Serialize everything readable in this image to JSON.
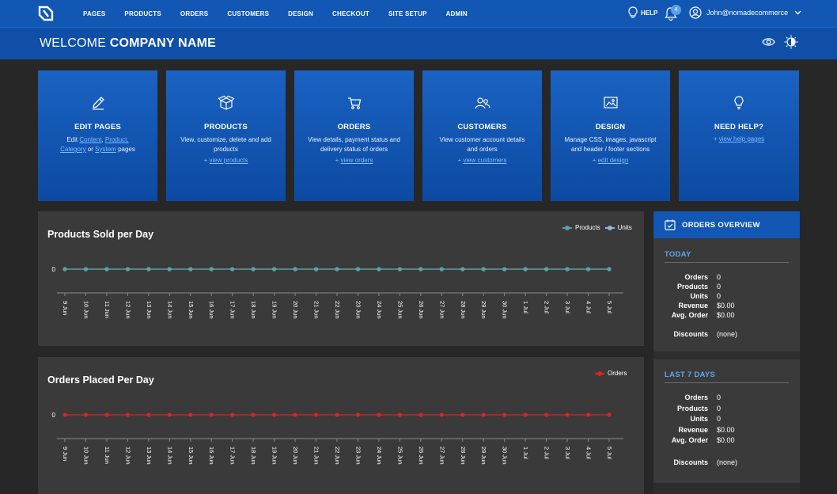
{
  "nav": {
    "items": [
      "PAGES",
      "PRODUCTS",
      "ORDERS",
      "CUSTOMERS",
      "DESIGN",
      "CHECKOUT",
      "SITE SETUP",
      "ADMIN"
    ],
    "help": "HELP",
    "notifications": "4",
    "user": "John@nomadecommerce"
  },
  "welcome": {
    "prefix": "WELCOME",
    "company": "COMPANY NAME"
  },
  "cards": {
    "edit": {
      "title": "EDIT PAGES",
      "edit_word": "Edit",
      "l1": "Content",
      "l2": "Product,",
      "l3": "Category",
      "or": "or",
      "l4": "System",
      "pages": "pages"
    },
    "products": {
      "title": "PRODUCTS",
      "desc": "View, customize, delete and add products",
      "plus": "+",
      "link": "view products"
    },
    "orders": {
      "title": "ORDERS",
      "desc": "View details, payment status and delivery status of orders",
      "plus": "+",
      "link": "view orders"
    },
    "customers": {
      "title": "CUSTOMERS",
      "desc": "View customer account details and orders",
      "plus": "+",
      "link": "view customers"
    },
    "design": {
      "title": "DESIGN",
      "desc": "Manage CSS, images, javascript and header / footer sections",
      "plus": "+",
      "link": "edit design"
    },
    "help": {
      "title": "NEED HELP?",
      "plus": "+",
      "link": "view help pages"
    }
  },
  "chart_data": [
    {
      "type": "line",
      "title": "Products Sold per Day",
      "x": [
        "9 Jun",
        "10 Jun",
        "11 Jun",
        "12 Jun",
        "13 Jun",
        "14 Jun",
        "15 Jun",
        "16 Jun",
        "17 Jun",
        "18 Jun",
        "19 Jun",
        "20 Jun",
        "21 Jun",
        "22 Jun",
        "23 Jun",
        "24 Jun",
        "25 Jun",
        "26 Jun",
        "27 Jun",
        "28 Jun",
        "29 Jun",
        "30 Jun",
        "1 Jul",
        "2 Jul",
        "3 Jul",
        "4 Jul",
        "5 Jul"
      ],
      "yticks": [
        "0"
      ],
      "series": [
        {
          "name": "Products",
          "color": "#5f9ea6",
          "values": [
            0,
            0,
            0,
            0,
            0,
            0,
            0,
            0,
            0,
            0,
            0,
            0,
            0,
            0,
            0,
            0,
            0,
            0,
            0,
            0,
            0,
            0,
            0,
            0,
            0,
            0,
            0
          ]
        },
        {
          "name": "Units",
          "color": "#8fb9dc",
          "values": [
            0,
            0,
            0,
            0,
            0,
            0,
            0,
            0,
            0,
            0,
            0,
            0,
            0,
            0,
            0,
            0,
            0,
            0,
            0,
            0,
            0,
            0,
            0,
            0,
            0,
            0,
            0
          ]
        }
      ],
      "legend": "top-right"
    },
    {
      "type": "line",
      "title": "Orders Placed Per Day",
      "x": [
        "9 Jun",
        "10 Jun",
        "11 Jun",
        "12 Jun",
        "13 Jun",
        "14 Jun",
        "15 Jun",
        "16 Jun",
        "17 Jun",
        "18 Jun",
        "19 Jun",
        "20 Jun",
        "21 Jun",
        "22 Jun",
        "23 Jun",
        "24 Jun",
        "25 Jun",
        "26 Jun",
        "27 Jun",
        "28 Jun",
        "29 Jun",
        "30 Jun",
        "1 Jul",
        "2 Jul",
        "3 Jul",
        "4 Jul",
        "5 Jul"
      ],
      "yticks": [
        "0"
      ],
      "series": [
        {
          "name": "Orders",
          "color": "#e02020",
          "values": [
            0,
            0,
            0,
            0,
            0,
            0,
            0,
            0,
            0,
            0,
            0,
            0,
            0,
            0,
            0,
            0,
            0,
            0,
            0,
            0,
            0,
            0,
            0,
            0,
            0,
            0,
            0
          ]
        }
      ],
      "legend": "top-right"
    }
  ],
  "overview": {
    "title": "ORDERS OVERVIEW",
    "today": {
      "label": "TODAY",
      "rows": [
        [
          "Orders",
          "0"
        ],
        [
          "Products",
          "0"
        ],
        [
          "Units",
          "0"
        ],
        [
          "Revenue",
          "$0.00"
        ],
        [
          "Avg. Order",
          "$0.00"
        ]
      ],
      "discounts": [
        "Discounts",
        "(none)"
      ]
    },
    "last7": {
      "label": "LAST 7 DAYS",
      "rows": [
        [
          "Orders",
          "0"
        ],
        [
          "Products",
          "0"
        ],
        [
          "Units",
          "0"
        ],
        [
          "Revenue",
          "$0.00"
        ],
        [
          "Avg. Order",
          "$0.00"
        ]
      ],
      "discounts": [
        "Discounts",
        "(none)"
      ]
    }
  }
}
